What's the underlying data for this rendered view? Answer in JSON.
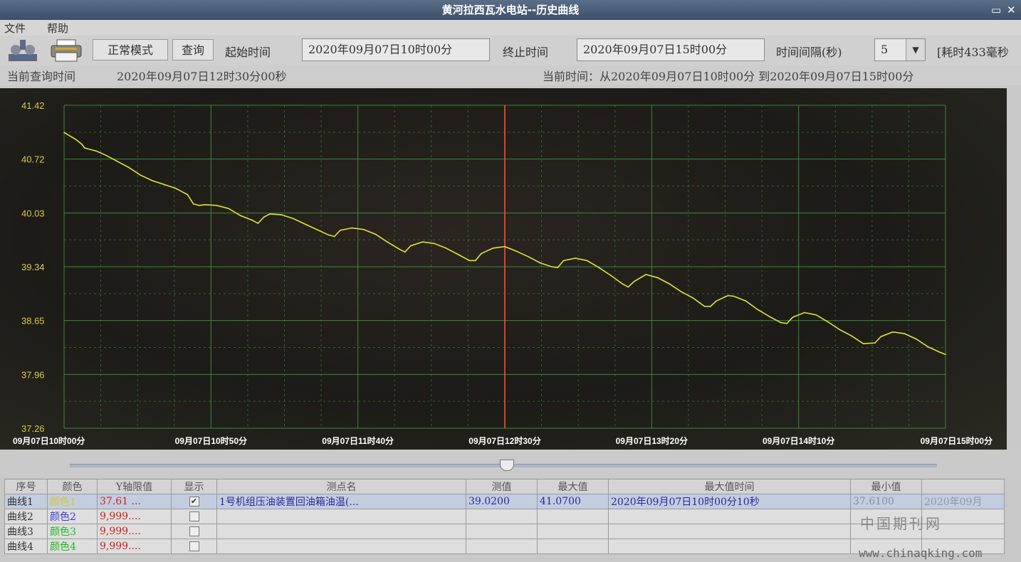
{
  "window": {
    "title": "黄河拉西瓦水电站--历史曲线",
    "min": "▭",
    "close": "✕"
  },
  "menu": [
    "文件",
    "帮助"
  ],
  "toolbar": {
    "mode_button": "正常模式",
    "query_button": "查询",
    "start_label": "起始时间",
    "start_value": "2020年09月07日10时00分",
    "end_label": "终止时间",
    "end_value": "2020年09月07日15时00分",
    "interval_label": "时间间隔(秒)",
    "interval_value": "5",
    "elapsed": "[耗时433毫秒"
  },
  "info": {
    "current_query_label": "当前查询时间",
    "current_query_value": "2020年09月07日12时30分00秒",
    "current_range": "当前时间：从2020年09月07日10时00分  到2020年09月07日15时00分"
  },
  "chart_data": {
    "type": "line",
    "y_ticks": [
      "41.42",
      "40.72",
      "40.03",
      "39.34",
      "38.65",
      "37.96",
      "37.26"
    ],
    "x_ticks": [
      "09月07日10时00分",
      "09月07日10时50分",
      "09月07日11时40分",
      "09月07日12时30分",
      "09月07日13时20分",
      "09月07日14时10分",
      "09月07日15时00分"
    ],
    "ylim": [
      37.26,
      41.42
    ],
    "xlim_minutes": [
      0,
      300
    ],
    "cursor_minute": 150,
    "grid": true,
    "series": [
      {
        "color": "#e0e23a",
        "points": [
          [
            0,
            41.07
          ],
          [
            4,
            40.98
          ],
          [
            6,
            40.92
          ],
          [
            7,
            40.87
          ],
          [
            8,
            40.86
          ],
          [
            11,
            40.83
          ],
          [
            14,
            40.78
          ],
          [
            18,
            40.7
          ],
          [
            22,
            40.62
          ],
          [
            26,
            40.52
          ],
          [
            30,
            40.45
          ],
          [
            34,
            40.4
          ],
          [
            38,
            40.35
          ],
          [
            42,
            40.27
          ],
          [
            44,
            40.15
          ],
          [
            46,
            40.13
          ],
          [
            48,
            40.14
          ],
          [
            52,
            40.13
          ],
          [
            56,
            40.09
          ],
          [
            60,
            40.0
          ],
          [
            64,
            39.94
          ],
          [
            66,
            39.9
          ],
          [
            68,
            39.98
          ],
          [
            70,
            40.02
          ],
          [
            74,
            40.01
          ],
          [
            78,
            39.96
          ],
          [
            82,
            39.89
          ],
          [
            86,
            39.82
          ],
          [
            90,
            39.75
          ],
          [
            92,
            39.73
          ],
          [
            94,
            39.81
          ],
          [
            98,
            39.84
          ],
          [
            102,
            39.82
          ],
          [
            106,
            39.76
          ],
          [
            110,
            39.66
          ],
          [
            114,
            39.57
          ],
          [
            116,
            39.53
          ],
          [
            118,
            39.61
          ],
          [
            122,
            39.66
          ],
          [
            126,
            39.64
          ],
          [
            130,
            39.58
          ],
          [
            134,
            39.5
          ],
          [
            138,
            39.42
          ],
          [
            140,
            39.42
          ],
          [
            142,
            39.51
          ],
          [
            146,
            39.58
          ],
          [
            150,
            39.6
          ],
          [
            154,
            39.54
          ],
          [
            158,
            39.47
          ],
          [
            162,
            39.39
          ],
          [
            166,
            39.34
          ],
          [
            168,
            39.33
          ],
          [
            170,
            39.42
          ],
          [
            174,
            39.45
          ],
          [
            178,
            39.42
          ],
          [
            182,
            39.33
          ],
          [
            186,
            39.23
          ],
          [
            190,
            39.12
          ],
          [
            192,
            39.08
          ],
          [
            194,
            39.15
          ],
          [
            198,
            39.24
          ],
          [
            202,
            39.2
          ],
          [
            206,
            39.12
          ],
          [
            210,
            39.02
          ],
          [
            214,
            38.94
          ],
          [
            218,
            38.83
          ],
          [
            220,
            38.83
          ],
          [
            222,
            38.9
          ],
          [
            226,
            38.97
          ],
          [
            228,
            38.96
          ],
          [
            232,
            38.9
          ],
          [
            236,
            38.79
          ],
          [
            240,
            38.7
          ],
          [
            244,
            38.62
          ],
          [
            246,
            38.61
          ],
          [
            248,
            38.69
          ],
          [
            252,
            38.75
          ],
          [
            256,
            38.72
          ],
          [
            260,
            38.63
          ],
          [
            264,
            38.53
          ],
          [
            268,
            38.45
          ],
          [
            272,
            38.35
          ],
          [
            276,
            38.36
          ],
          [
            278,
            38.44
          ],
          [
            282,
            38.5
          ],
          [
            286,
            38.48
          ],
          [
            290,
            38.41
          ],
          [
            294,
            38.31
          ],
          [
            298,
            38.24
          ],
          [
            300,
            38.21
          ]
        ]
      }
    ]
  },
  "table": {
    "headers": [
      "序号",
      "颜色",
      "Y轴限值",
      "显示",
      "测点名",
      "测值",
      "最大值",
      "最大值时间",
      "最小值"
    ],
    "rows": [
      {
        "no": "曲线1",
        "color": "颜色1",
        "ylim": "37.61 ...",
        "show": "✔",
        "name": "1号机组压油装置回油箱油温(...",
        "value": "39.0200",
        "max": "41.0700",
        "maxtime": "2020年09月07日10时00分10秒",
        "min": "37.6100",
        "extra": "2020年09月"
      },
      {
        "no": "曲线2",
        "color": "颜色2",
        "ylim": "9,999....",
        "show": "",
        "name": "",
        "value": "",
        "max": "",
        "maxtime": "",
        "min": "",
        "extra": ""
      },
      {
        "no": "曲线3",
        "color": "颜色3",
        "ylim": "9,999....",
        "show": "",
        "name": "",
        "value": "",
        "max": "",
        "maxtime": "",
        "min": "",
        "extra": ""
      },
      {
        "no": "曲线4",
        "color": "颜色4",
        "ylim": "9,999....",
        "show": "",
        "name": "",
        "value": "",
        "max": "",
        "maxtime": "",
        "min": "",
        "extra": ""
      }
    ]
  },
  "colors": {
    "row_colors": [
      "#d8c832",
      "#3a3ae0",
      "#20b820",
      "#20b820"
    ],
    "ylim_color": "#d02020"
  },
  "watermark": {
    "text1": "中国期刊网",
    "text2": "www.chinaqking.com"
  }
}
